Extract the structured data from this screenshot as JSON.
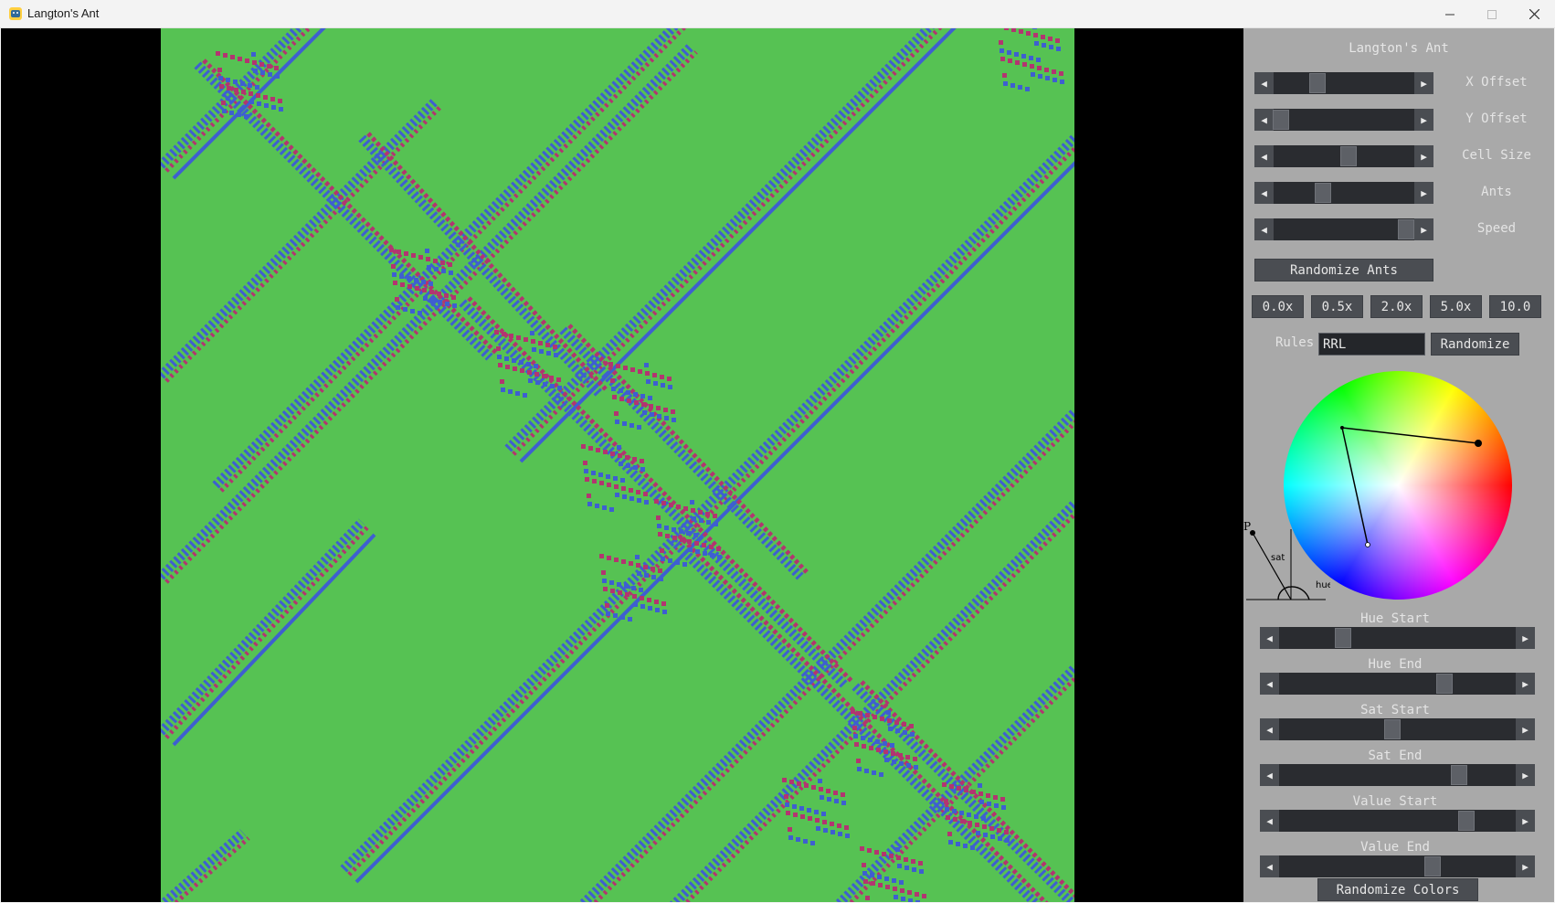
{
  "window": {
    "title": "Langton's Ant"
  },
  "panel": {
    "title": "Langton's Ant",
    "sliders_top": [
      {
        "name": "x-offset",
        "label": "X Offset",
        "value": 0.31
      },
      {
        "name": "y-offset",
        "label": "Y Offset",
        "value": 0.05
      },
      {
        "name": "cell-size",
        "label": "Cell Size",
        "value": 0.53
      },
      {
        "name": "ants",
        "label": "Ants",
        "value": 0.35
      },
      {
        "name": "speed",
        "label": "Speed",
        "value": 0.94
      }
    ],
    "randomize_ants_label": "Randomize Ants",
    "speed_buttons": [
      "0.0x",
      "0.5x",
      "2.0x",
      "5.0x",
      "10.0"
    ],
    "rules": {
      "label": "Rules",
      "value": "RRL",
      "randomize_label": "Randomize"
    },
    "diagram": {
      "p": "P",
      "sat": "sat",
      "hue": "hue"
    },
    "sliders_color": [
      {
        "name": "hue-start",
        "label": "Hue Start",
        "value": 0.27
      },
      {
        "name": "hue-end",
        "label": "Hue End",
        "value": 0.7
      },
      {
        "name": "sat-start",
        "label": "Sat Start",
        "value": 0.48
      },
      {
        "name": "sat-end",
        "label": "Sat End",
        "value": 0.76
      },
      {
        "name": "value-start",
        "label": "Value Start",
        "value": 0.79
      },
      {
        "name": "value-end",
        "label": "Value End",
        "value": 0.65
      }
    ],
    "randomize_colors_label": "Randomize Colors"
  },
  "colors": {
    "cell_background": "#56c253",
    "cell_blue": "#3e5fd0",
    "cell_magenta": "#b23570",
    "panel_bg": "#a9a9a9"
  }
}
